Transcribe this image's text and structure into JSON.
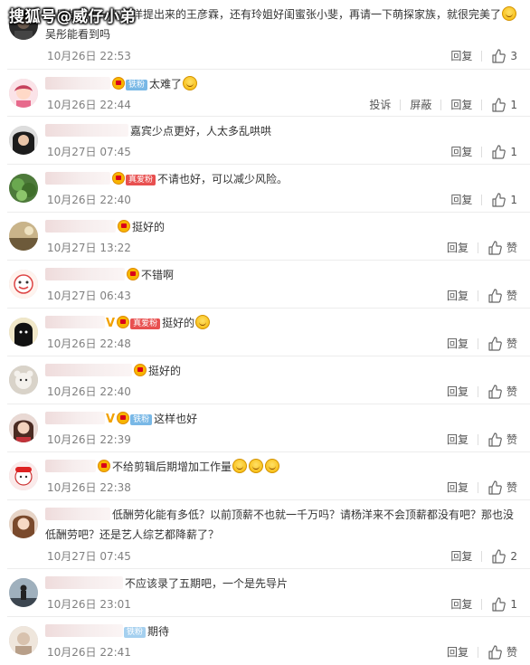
{
  "watermark": "搜狐号@威仔小弟",
  "comments": [
    {
      "name": "",
      "text_pre": "我只想要请一下杨洋提出来的王彦霖，还有玲姐好闺蜜张小斐，再请一下萌探家族，就很完美了",
      "text_post": "吴彤能看到吗",
      "time": "10月26日 22:53",
      "reply": "回复",
      "like_count": "3",
      "avatar": "dark-portrait"
    },
    {
      "badge": "铁粉",
      "text": "太难了",
      "time": "10月26日 22:44",
      "report": "投诉",
      "block": "屏蔽",
      "reply": "回复",
      "like_count": "1",
      "avatar": "pink-girl"
    },
    {
      "text": "嘉宾少点更好，人太多乱哄哄",
      "time": "10月27日 07:45",
      "reply": "回复",
      "like_count": "1",
      "avatar": "dark-hair-girl"
    },
    {
      "badge": "真爱粉",
      "text": "不请也好，可以减少风险。",
      "time": "10月26日 22:40",
      "reply": "回复",
      "like_count": "1",
      "avatar": "green-plant"
    },
    {
      "text": "挺好的",
      "time": "10月27日 13:22",
      "reply": "回复",
      "like_label": "赞",
      "avatar": "landscape"
    },
    {
      "text": "不错啊",
      "time": "10月27日 06:43",
      "reply": "回复",
      "like_label": "赞",
      "avatar": "cartoon-face"
    },
    {
      "badge": "真爱粉",
      "text": "挺好的",
      "time": "10月26日 22:48",
      "reply": "回复",
      "like_label": "赞",
      "avatar": "black-hood"
    },
    {
      "text": "挺好的",
      "time": "10月26日 22:40",
      "reply": "回复",
      "like_label": "赞",
      "avatar": "bear"
    },
    {
      "badge": "铁粉",
      "text": "这样也好",
      "time": "10月26日 22:39",
      "reply": "回复",
      "like_label": "赞",
      "avatar": "girl-red"
    },
    {
      "text": "不给剪辑后期增加工作量",
      "time": "10月26日 22:38",
      "reply": "回复",
      "like_label": "赞",
      "avatar": "cartoon-red"
    },
    {
      "text": "低酬劳化能有多低？以前顶薪不也就一千万吗？请杨洋来不会顶薪都没有吧？那也没低酬劳吧？还是艺人综艺都降薪了？",
      "time": "10月27日 07:45",
      "reply": "回复",
      "like_count": "2",
      "avatar": "brown-hair-girl"
    },
    {
      "text": "不应该录了五期吧，一个是先导片",
      "time": "10月26日 23:01",
      "reply": "回复",
      "like_count": "1",
      "avatar": "silhouette"
    },
    {
      "badge": "铁粉",
      "text": "期待",
      "time": "10月26日 22:41",
      "reply": "回复",
      "like_label": "赞",
      "avatar": "light-portrait"
    }
  ]
}
